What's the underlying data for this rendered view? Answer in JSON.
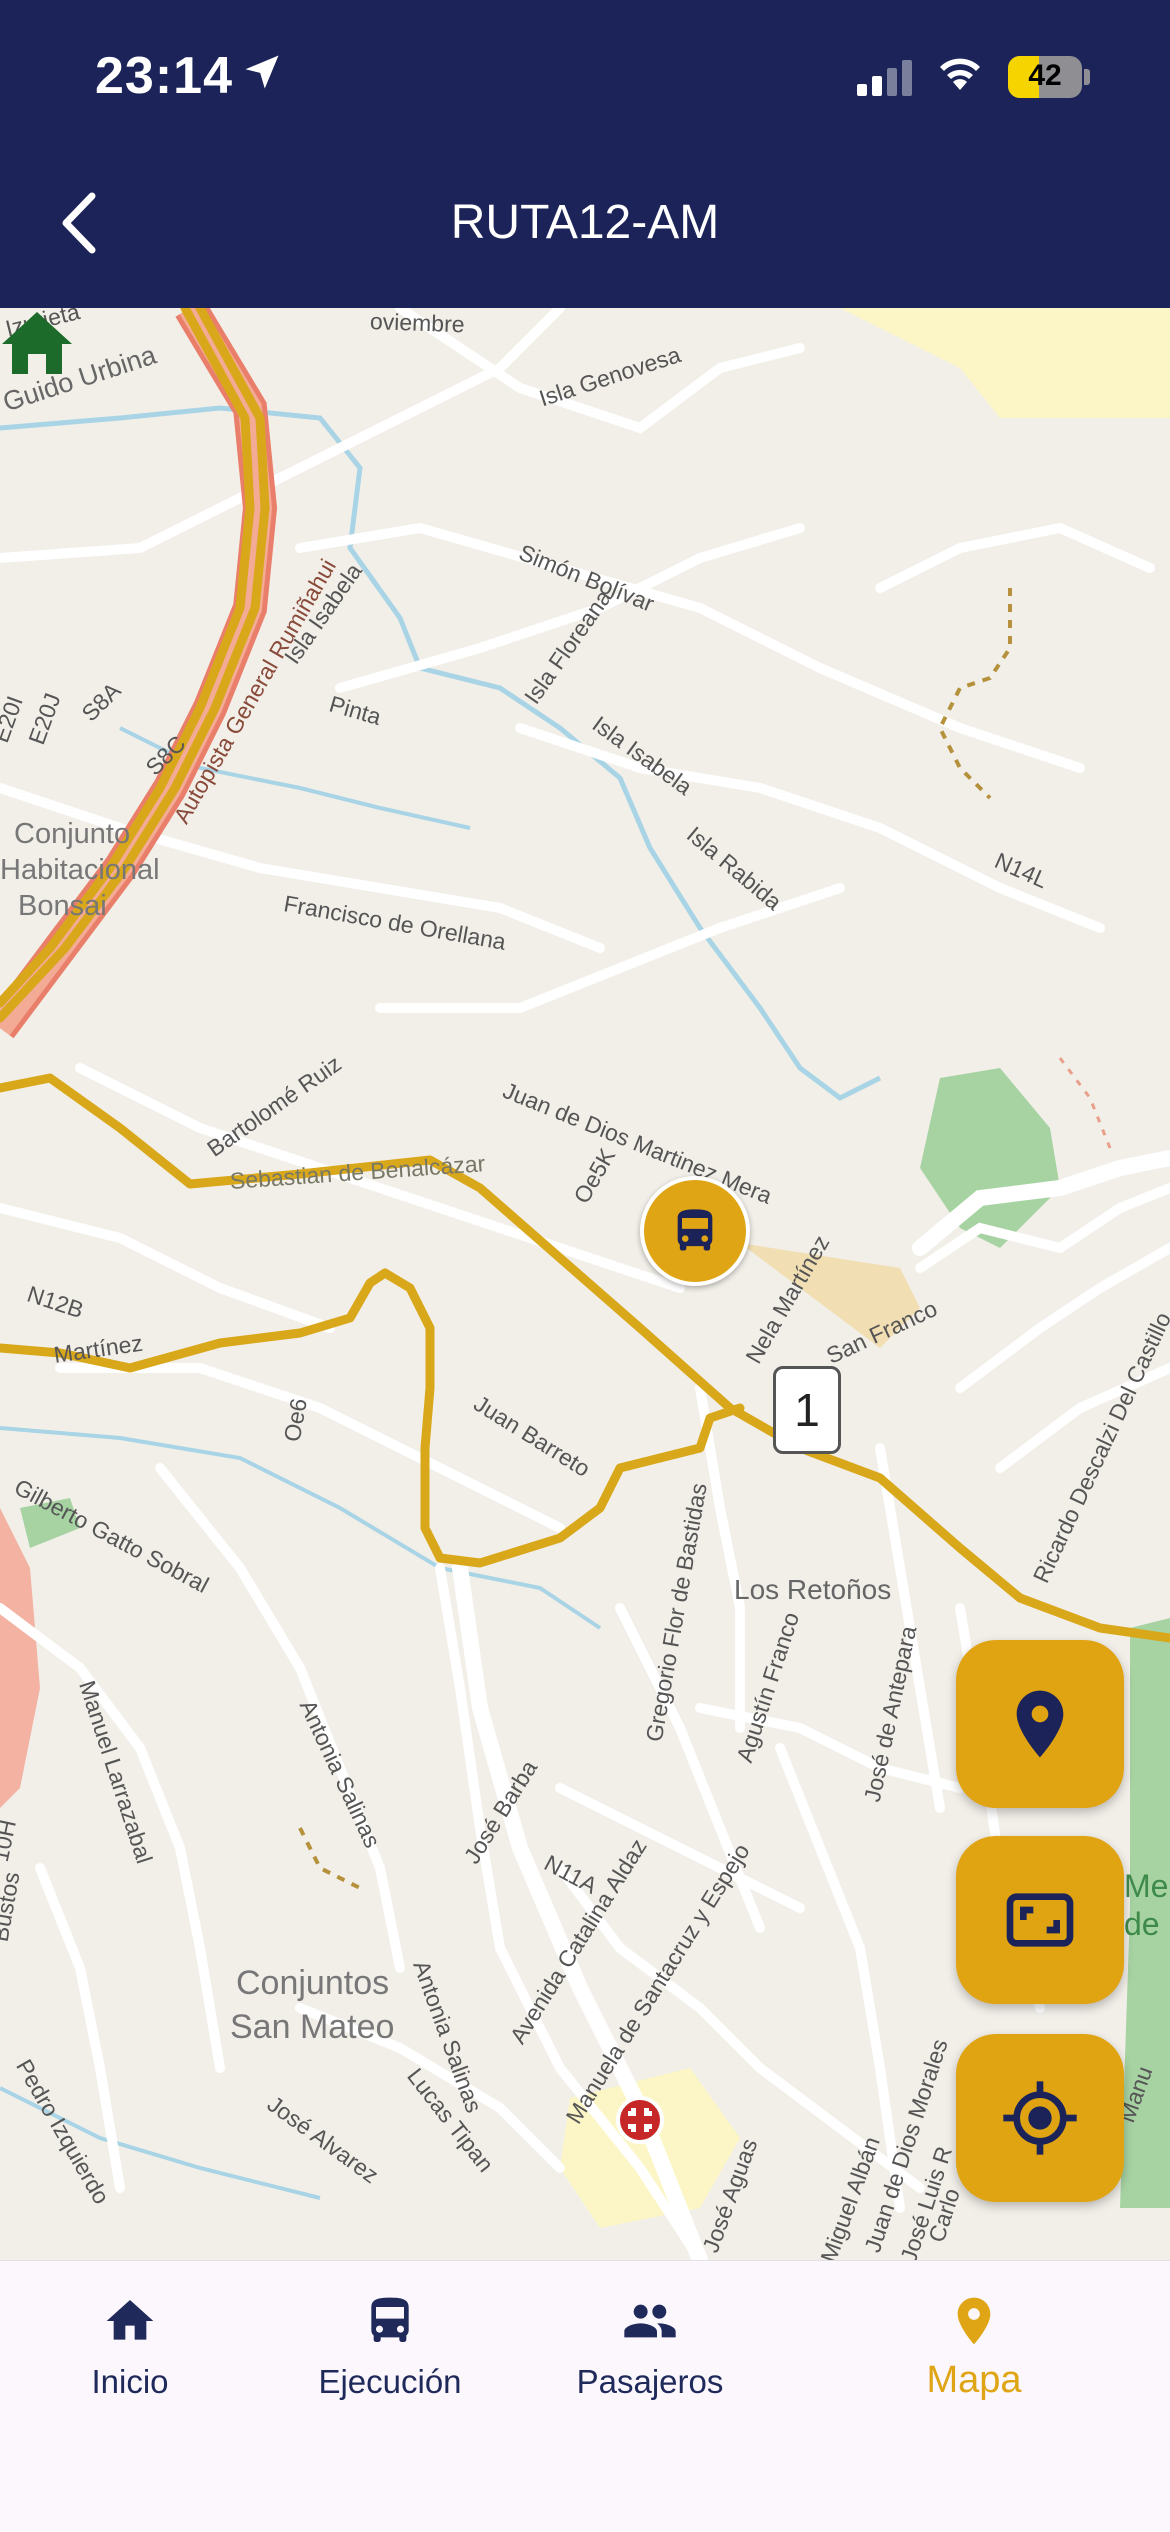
{
  "status_bar": {
    "time": "23:14",
    "battery": "42",
    "battery_level": 0.42
  },
  "header": {
    "title": "RUTA12-AM"
  },
  "map": {
    "stop_number": "1",
    "labels": {
      "izurieta": "Izurieta",
      "noviembre": "oviembre",
      "guido_urbina": "Guido Urbina",
      "isla_genovesa": "Isla Genovesa",
      "simon_bolivar": "Simón Bolívar",
      "isla_isabela_1": "Isla Isabela",
      "isla_floreana": "Isla Floreana",
      "isla_isabela_2": "Isla Isabela",
      "isla_rabida": "Isla Rabida",
      "n14l": "N14L",
      "pinta": "Pinta",
      "s8a": "S8A",
      "s8c": "S8C",
      "e20j": "E20J",
      "e20i": "E20I",
      "autopista": "Autopista General Rumiñahui",
      "conjunto_1": "Conjunto",
      "conjunto_2": "Habitacional",
      "conjunto_3": "Bonsai",
      "francisco_orellana": "Francisco de Orellana",
      "bartolome_ruiz": "Bartolomé Ruiz",
      "juan_de_dios": "Juan de Dios Martinez Mera",
      "oe5k": "Oe5K",
      "nela_martinez": "Nela Martínez",
      "san_franco": "San Franco",
      "sebastian": "Sebastian de Benalcázar",
      "n12b": "N12B",
      "martinez": "Martínez",
      "oe6": "Oe6",
      "juan_barreto": "Juan Barreto",
      "ricardo": "Ricardo Descalzi Del Castillo",
      "gilberto": "Gilberto Gatto Sobral",
      "los_retonos": "Los Retoños",
      "gregorio": "Gregorio Flor de Bastidas",
      "agustin": "Agustín Franco",
      "jose_antepara": "José de Antepara",
      "manuel_larrazabal": "Manuel Larrazabal",
      "antonia_salinas_1": "Antonia Salinas",
      "jose_barba": "José Barba",
      "n11a": "N11A",
      "catalina": "Avenida Catalina Aldaz",
      "manuela": "Manuela de Santacruz y Espejo",
      "conjuntos_1": "Conjuntos",
      "conjuntos_2": "San Mateo",
      "antonia_salinas_2": "Antonia Salinas",
      "lucas_tipan": "Lucas Tipan",
      "jose_alvarez": "José Alvarez",
      "pedro_izquierdo": "Pedro Izquierdo",
      "bustos": "Bustos",
      "oh10": "10H",
      "jose_aguas": "José Aguas",
      "miguel_alban": "Miguel Albán",
      "juan_de_dios_morales": "Juan de Dios Morales",
      "jose_luis": "José Luis R",
      "carlos": "Carlo",
      "me_de": "Me",
      "de": "de",
      "manu": "Manu"
    }
  },
  "nav": {
    "items": [
      {
        "label": "Inicio",
        "icon": "home-icon"
      },
      {
        "label": "Ejecución",
        "icon": "bus-icon"
      },
      {
        "label": "Pasajeros",
        "icon": "people-icon"
      },
      {
        "label": "Mapa",
        "icon": "map-pin-icon",
        "active": true
      }
    ]
  },
  "colors": {
    "header_bg": "#1c2358",
    "accent": "#dfa515",
    "nav_active": "#dfa515",
    "nav_inactive": "#1f2a5a",
    "route": "#d9a71a",
    "highway": "#f0a391",
    "water": "#a8d4e6",
    "park": "#a7d3a3",
    "home_marker": "#1c6b2a"
  }
}
